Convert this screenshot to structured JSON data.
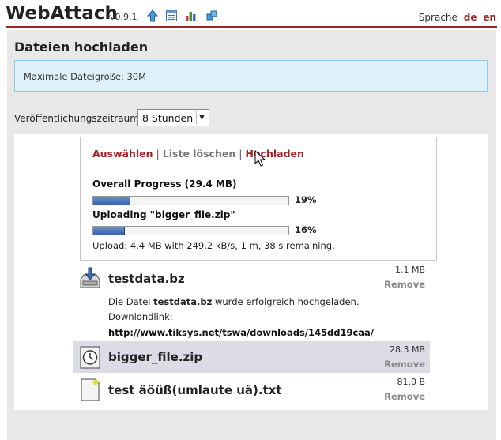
{
  "header": {
    "app_title": "WebAttach",
    "version": "v0.9.1",
    "icons": [
      "upload-arrow-icon",
      "list-icon",
      "chart-icon",
      "puzzle-icon"
    ],
    "language_label": "Sprache",
    "languages": [
      "de",
      "en"
    ]
  },
  "page": {
    "title": "Dateien hochladen",
    "info_text": "Maximale Dateigröße: 30M",
    "period_label": "Veröffentlichungszeitraum:",
    "period_selected": "8 Stunden"
  },
  "controls": {
    "select_label": "Auswählen",
    "clear_label": "Liste löschen",
    "upload_label": "Hochladen",
    "separator": "|",
    "overall_label": "Overall Progress (29.4 MB)",
    "overall_pct_text": "19%",
    "overall_pct": 19,
    "uploading_label": "Uploading \"bigger_file.zip\"",
    "file_pct_text": "16%",
    "file_pct": 16,
    "status_text": "Upload: 4.4 MB with 249.2 kB/s, 1 m, 38 s remaining."
  },
  "files": [
    {
      "name": "testdata.bz",
      "size": "1.1 MB",
      "remove_label": "Remove",
      "icon": "download-done-icon",
      "msg_prefix": "Die Datei",
      "msg_file": "testdata.bz",
      "msg_suffix": "wurde erfolgreich hochgeladen.",
      "link_label": "Downlondlink:",
      "link": "http://www.tiksys.net/tswa/downloads/145dd19caa/"
    },
    {
      "name": "bigger_file.zip",
      "size": "28.3 MB",
      "remove_label": "Remove",
      "icon": "clock-icon"
    },
    {
      "name": "test äöüß(umlaute uä).txt",
      "size": "81.0 B",
      "remove_label": "Remove",
      "icon": "file-icon"
    }
  ],
  "colors": {
    "accent": "#a02525",
    "info_bg": "#dff2fb",
    "info_border": "#8ccde6",
    "progress": "#3a63b0",
    "highlight_row": "#dcdce6"
  }
}
